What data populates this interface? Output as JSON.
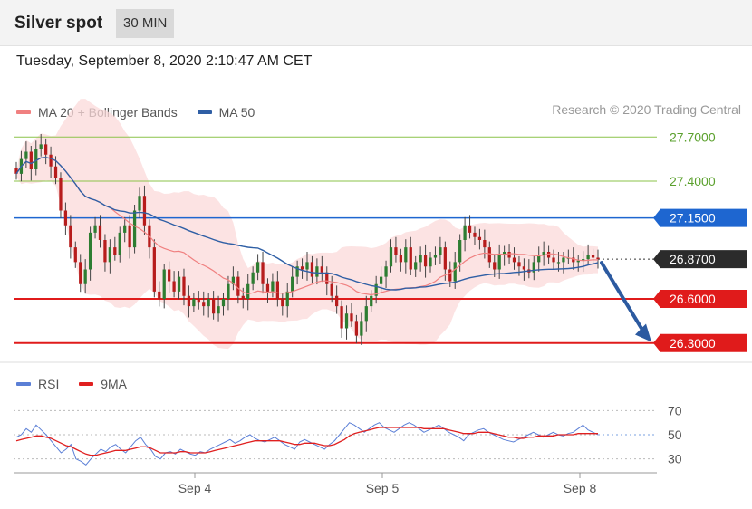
{
  "header": {
    "title": "Silver spot",
    "interval": "30 MIN"
  },
  "timestamp": "Tuesday, September 8, 2020 2:10:47 AM CET",
  "legend": [
    {
      "label": "MA 20 + Bollinger Bands",
      "color": "#f08080"
    },
    {
      "label": "MA 50",
      "color": "#2f5fa5"
    }
  ],
  "copyright": "Research © 2020 Trading Central",
  "rsi_legend": [
    {
      "label": "RSI",
      "color": "#5b7fd6"
    },
    {
      "label": "9MA",
      "color": "#e02020"
    }
  ],
  "chart_data": [
    {
      "type": "candlestick",
      "title": "Silver spot",
      "x_labels": [
        "Sep 4",
        "Sep 5",
        "Sep 8"
      ],
      "ylim": [
        26.2,
        27.8
      ],
      "levels": [
        {
          "value": 27.7,
          "label": "27.7000",
          "role": "resistance",
          "color": "#8bc34a"
        },
        {
          "value": 27.4,
          "label": "27.4000",
          "role": "resistance",
          "color": "#8bc34a"
        },
        {
          "value": 27.15,
          "label": "27.1500",
          "role": "pivot",
          "color": "#1e66d0"
        },
        {
          "value": 26.87,
          "label": "26.8700",
          "role": "last",
          "color": "#333333"
        },
        {
          "value": 26.6,
          "label": "26.6000",
          "role": "support",
          "color": "#e01b1b"
        },
        {
          "value": 26.3,
          "label": "26.3000",
          "role": "support",
          "color": "#e01b1b"
        }
      ],
      "close": [
        27.45,
        27.55,
        27.6,
        27.48,
        27.62,
        27.65,
        27.58,
        27.5,
        27.42,
        27.2,
        27.1,
        26.95,
        26.85,
        26.7,
        26.8,
        27.05,
        27.1,
        27.0,
        26.85,
        26.95,
        26.9,
        27.05,
        27.1,
        26.95,
        27.2,
        27.3,
        27.1,
        26.95,
        26.65,
        26.6,
        26.8,
        26.72,
        26.65,
        26.75,
        26.62,
        26.55,
        26.6,
        26.58,
        26.55,
        26.6,
        26.5,
        26.55,
        26.6,
        26.7,
        26.75,
        26.62,
        26.6,
        26.7,
        26.78,
        26.85,
        26.7,
        26.65,
        26.72,
        26.6,
        26.55,
        26.65,
        26.75,
        26.82,
        26.8,
        26.85,
        26.75,
        26.82,
        26.78,
        26.7,
        26.62,
        26.55,
        26.4,
        26.5,
        26.45,
        26.35,
        26.45,
        26.55,
        26.62,
        26.7,
        26.75,
        26.82,
        26.95,
        26.9,
        26.85,
        26.95,
        26.8,
        26.85,
        26.9,
        26.82,
        26.88,
        26.9,
        26.95,
        26.8,
        26.72,
        26.85,
        27.0,
        27.1,
        27.05,
        27.02,
        27.0,
        26.95,
        26.85,
        26.8,
        26.9,
        26.92,
        26.88,
        26.85,
        26.82,
        26.8,
        26.78,
        26.85,
        26.9,
        26.92,
        26.88,
        26.85,
        26.85,
        26.88,
        26.88,
        26.85,
        26.86,
        26.87,
        26.9,
        26.88,
        26.87
      ]
    },
    {
      "type": "line",
      "title": "RSI",
      "ylim": [
        20,
        80
      ],
      "yticks": [
        30,
        50,
        70
      ],
      "series": [
        {
          "name": "RSI",
          "color": "#5b7fd6",
          "values": [
            48,
            50,
            55,
            52,
            58,
            54,
            50,
            45,
            40,
            35,
            38,
            42,
            30,
            28,
            25,
            30,
            34,
            38,
            36,
            40,
            42,
            38,
            35,
            40,
            45,
            48,
            42,
            38,
            32,
            30,
            35,
            36,
            34,
            38,
            36,
            34,
            33,
            36,
            35,
            38,
            40,
            42,
            44,
            46,
            43,
            45,
            48,
            50,
            47,
            45,
            44,
            46,
            48,
            45,
            42,
            40,
            38,
            44,
            46,
            44,
            42,
            40,
            38,
            42,
            45,
            50,
            55,
            60,
            58,
            55,
            52,
            55,
            58,
            60,
            56,
            54,
            52,
            55,
            58,
            60,
            58,
            55,
            52,
            54,
            56,
            58,
            55,
            52,
            50,
            48,
            45,
            50,
            52,
            54,
            55,
            52,
            50,
            48,
            46,
            45,
            44,
            46,
            48,
            50,
            52,
            50,
            48,
            50,
            52,
            50,
            49,
            51,
            52,
            55,
            58,
            54,
            52,
            50
          ]
        },
        {
          "name": "9MA",
          "color": "#e02020",
          "values": [
            45,
            46,
            47,
            48,
            49,
            49,
            48,
            47,
            45,
            43,
            41,
            40,
            38,
            36,
            34,
            33,
            33,
            34,
            35,
            36,
            37,
            37,
            37,
            38,
            39,
            40,
            40,
            39,
            37,
            35,
            35,
            35,
            35,
            36,
            36,
            35,
            35,
            35,
            35,
            36,
            37,
            38,
            39,
            40,
            41,
            42,
            43,
            44,
            45,
            45,
            45,
            45,
            45,
            45,
            44,
            43,
            42,
            42,
            43,
            43,
            43,
            42,
            41,
            41,
            42,
            44,
            46,
            49,
            51,
            52,
            53,
            54,
            55,
            56,
            56,
            56,
            56,
            56,
            56,
            56,
            56,
            56,
            55,
            55,
            55,
            55,
            55,
            54,
            53,
            52,
            51,
            51,
            51,
            52,
            52,
            52,
            51,
            50,
            49,
            48,
            48,
            47,
            47,
            48,
            48,
            49,
            49,
            49,
            49,
            50,
            50,
            50,
            50,
            51,
            51,
            51,
            51,
            51
          ]
        }
      ]
    }
  ]
}
